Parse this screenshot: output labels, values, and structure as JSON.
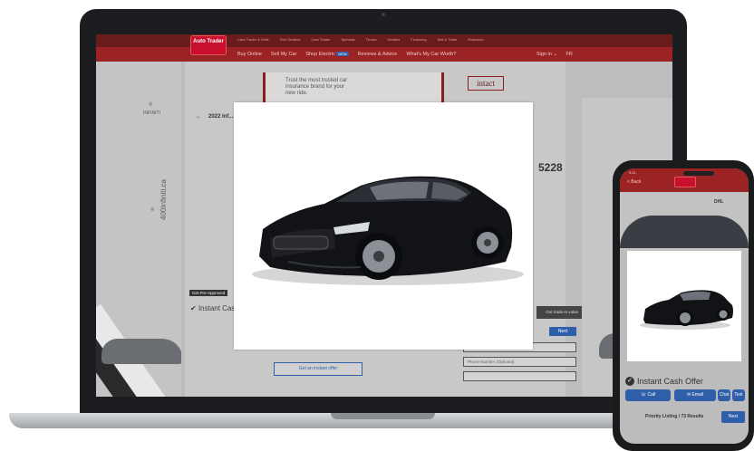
{
  "site": {
    "logo": "Auto Trader",
    "top_links": [
      "Cars Trader & Sells",
      "Find Dealers",
      "Cars Trader",
      "Specials",
      "Trucks",
      "Dealers",
      "Financing",
      "Sell & Trade",
      "Research"
    ],
    "nav": [
      "Buy Online",
      "Sell My Car",
      "Shop Electric",
      "Reviews & Advice",
      "What's My Car Worth?"
    ],
    "nav_new_badge": "NEW",
    "sign_in": "Sign in",
    "language": "FR",
    "breadcrumb": "2022 Inf...",
    "ad_text": "Trust the most trusted car insurance brand for your new ride.",
    "ad_brand": "intact",
    "phone_number": "5228",
    "vertical_url": "400Infiniti.ca",
    "dealer_brand": "INFINITI",
    "dark_tag": "Get Pre-Approved",
    "instant_partial": "Instant Cas",
    "next": "Next",
    "offer_button": "Get an instant offer",
    "form_fields": [
      "Email*",
      "Phone Number (Optional)",
      ""
    ],
    "dark_strip": "Get trade-in value"
  },
  "phone": {
    "time": "9:41",
    "back": "< Back",
    "brand": "DHL",
    "instant_cash": "Instant Cash Offer",
    "call": "Call",
    "email": "Email",
    "chat": "Chat",
    "text": "Text",
    "priority": "Priority Listing / 73 Results",
    "next": "Next"
  },
  "colors": {
    "brand_red": "#9b2323",
    "accent_blue": "#2f5fa8",
    "car_black": "#111214"
  }
}
